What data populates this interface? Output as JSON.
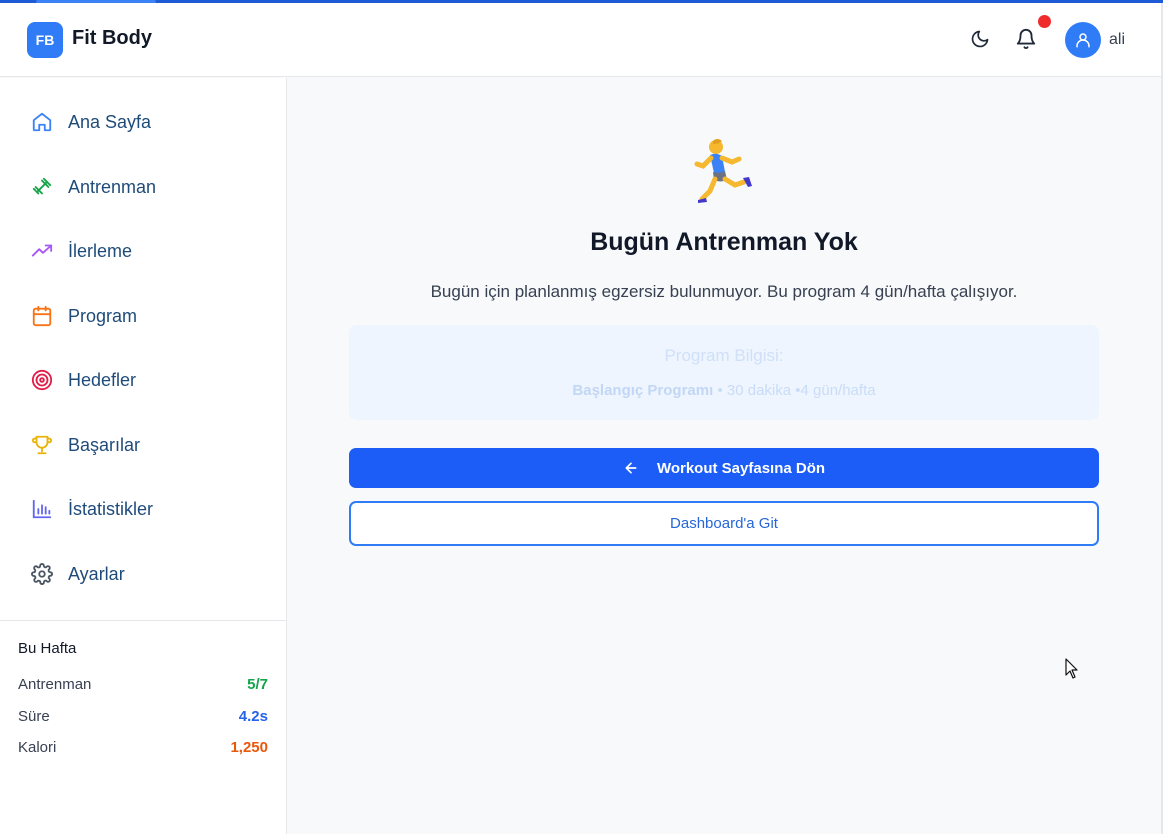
{
  "header": {
    "logo_text": "FB",
    "brand": "Fit Body",
    "username": "ali",
    "icons": [
      "moon-icon",
      "bell-icon",
      "user-icon"
    ]
  },
  "sidebar": {
    "items": [
      {
        "label": "Ana Sayfa",
        "icon": "home-icon",
        "color": "#3b82f6"
      },
      {
        "label": "Antrenman",
        "icon": "dumbbell-icon",
        "color": "#16a34a"
      },
      {
        "label": "İlerleme",
        "icon": "trending-up-icon",
        "color": "#a855f7"
      },
      {
        "label": "Program",
        "icon": "calendar-icon",
        "color": "#f97316"
      },
      {
        "label": "Hedefler",
        "icon": "target-icon",
        "color": "#e11d48"
      },
      {
        "label": "Başarılar",
        "icon": "trophy-icon",
        "color": "#eab308"
      },
      {
        "label": "İstatistikler",
        "icon": "bar-chart-icon",
        "color": "#6366f1"
      },
      {
        "label": "Ayarlar",
        "icon": "gear-icon",
        "color": "#4b5563"
      }
    ],
    "week": {
      "title": "Bu Hafta",
      "stats": [
        {
          "label": "Antrenman",
          "value": "5/7",
          "color": "#16a34a"
        },
        {
          "label": "Süre",
          "value": "4.2s",
          "color": "#2563eb"
        },
        {
          "label": "Kalori",
          "value": "1,250",
          "color": "#ea580c"
        }
      ]
    }
  },
  "main": {
    "emoji": "🏃",
    "title": "Bugün Antrenman Yok",
    "subtitle": "Bugün için planlanmış egzersiz bulunmuyor. Bu program 4 gün/hafta çalışıyor.",
    "info": {
      "title": "Program Bilgisi:",
      "program": "Başlangıç Programı",
      "sep1": " • ",
      "duration": "30 dakika",
      "sep2": " •",
      "frequency": "4 gün/hafta"
    },
    "primary_button": "Workout Sayfasına Dön",
    "secondary_button": "Dashboard'a Git"
  },
  "colors": {
    "accent": "#1b5df6",
    "notification": "#ef2b2b"
  }
}
